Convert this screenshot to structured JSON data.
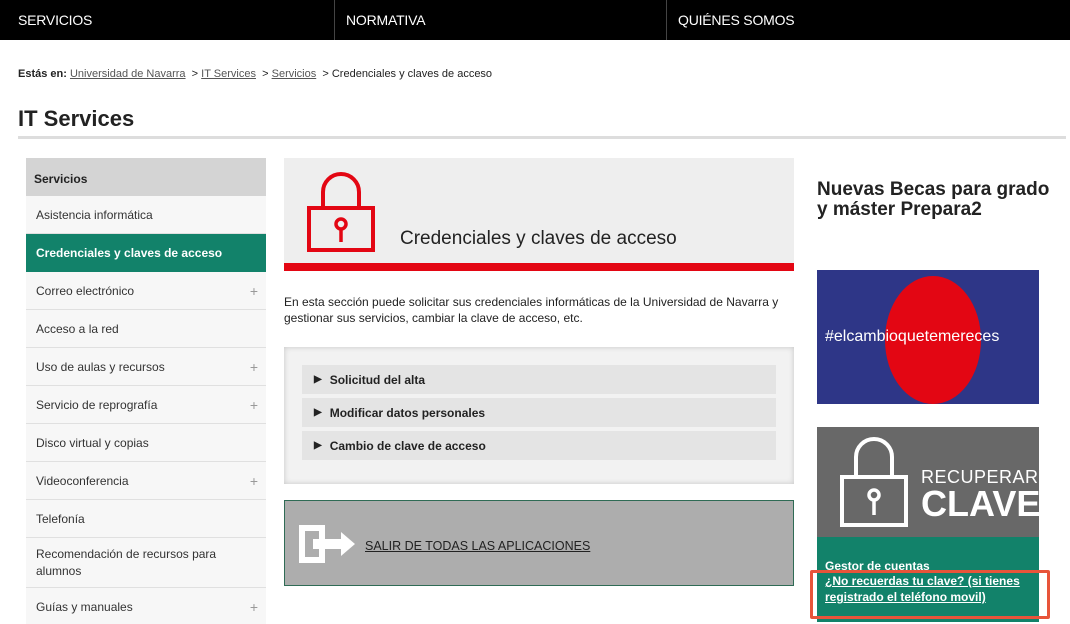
{
  "nav": {
    "items": [
      {
        "label": "SERVICIOS"
      },
      {
        "label": "NORMATIVA"
      },
      {
        "label": "QUIÉNES SOMOS"
      }
    ]
  },
  "breadcrumb": {
    "prefix": "Estás en:",
    "links": [
      "Universidad de Navarra",
      "IT Services",
      "Servicios"
    ],
    "separator": ">",
    "current": "Credenciales y claves de acceso"
  },
  "page": {
    "title": "IT Services"
  },
  "sidebar": {
    "heading": "Servicios",
    "items": [
      {
        "label": "Asistencia informática",
        "expandable": false
      },
      {
        "label": "Credenciales y claves de acceso",
        "expandable": false,
        "active": true
      },
      {
        "label": "Correo electrónico",
        "expandable": true
      },
      {
        "label": "Acceso a la red",
        "expandable": false
      },
      {
        "label": "Uso de aulas y recursos",
        "expandable": true
      },
      {
        "label": "Servicio de reprografía",
        "expandable": true
      },
      {
        "label": "Disco virtual y copias",
        "expandable": false
      },
      {
        "label": "Videoconferencia",
        "expandable": true
      },
      {
        "label": "Telefonía",
        "expandable": false
      },
      {
        "label": "Recomendación de recursos para alumnos",
        "expandable": false
      },
      {
        "label": "Guías y manuales",
        "expandable": true
      }
    ],
    "plus_glyph": "+"
  },
  "main": {
    "hero_title": "Credenciales y claves de acceso",
    "intro": "En esta sección puede solicitar sus credenciales informáticas de la Universidad de Navarra y gestionar sus servicios, cambiar la clave de acceso, etc.",
    "accordion": [
      {
        "label": "Solicitud del alta"
      },
      {
        "label": "Modificar datos personales"
      },
      {
        "label": "Cambio de clave de acceso"
      }
    ],
    "logout_label": "SALIR DE TODAS LAS APLICACIONES"
  },
  "aside": {
    "promo_title": "Nuevas Becas para grado y máster Prepara2",
    "promo_hashtag": "#elcambioquetemereces",
    "recover_line1": "RECUPERAR",
    "recover_line2": "CLAVE",
    "accounts_title": "Gestor de cuentas",
    "accounts_link": "¿No recuerdas tu clave? (si tienes registrado el teléfono movil)"
  },
  "colors": {
    "accent_green": "#12826a",
    "brand_red": "#e30613",
    "promo_blue": "#2e3687",
    "highlight": "#e8543a"
  }
}
